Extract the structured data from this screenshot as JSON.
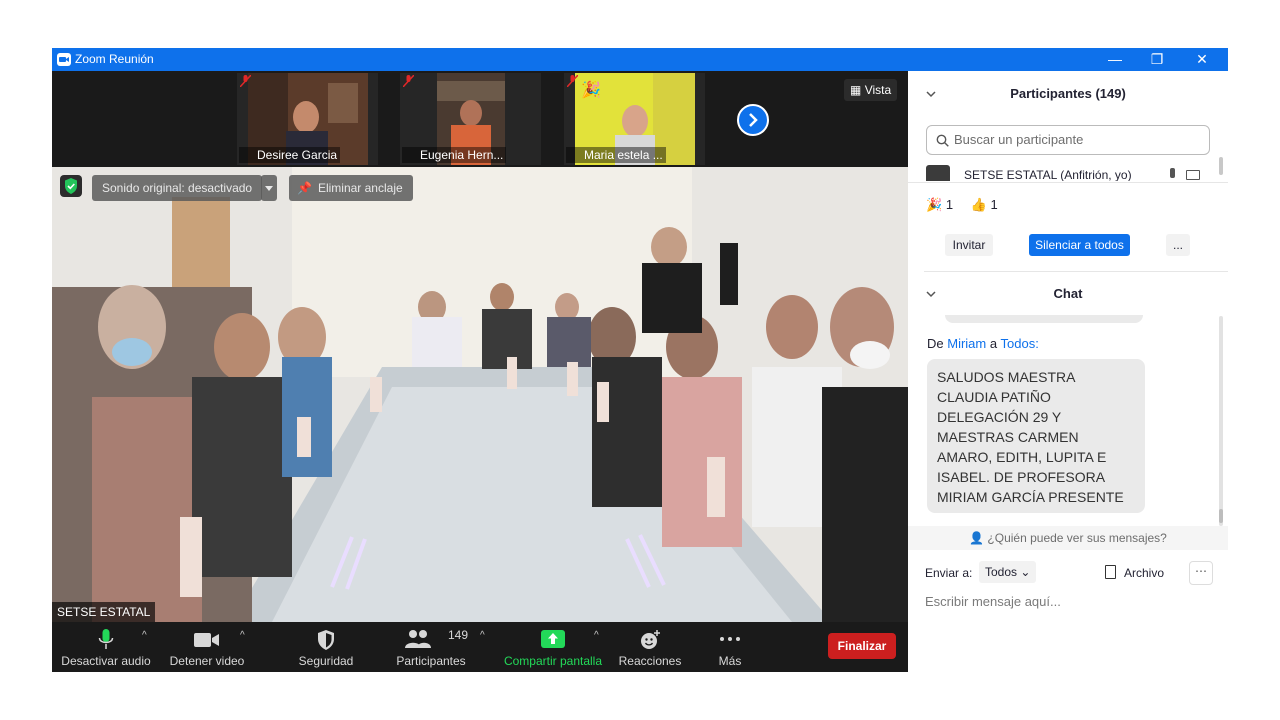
{
  "window": {
    "title": "Zoom Reunión",
    "min": "—",
    "restore": "❐",
    "close": "✕"
  },
  "strip": {
    "thumbs": [
      {
        "name": "Desiree Garcia"
      },
      {
        "name": "Eugenia Hern..."
      },
      {
        "name": "Maria estela ..."
      }
    ],
    "view_label": "Vista"
  },
  "main": {
    "sound_label": "Sonido original: desactivado",
    "unpin_label": "Eliminar anclaje",
    "speaker_name": "SETSE ESTATAL"
  },
  "toolbar": {
    "audio_label": "Desactivar audio",
    "video_label": "Detener video",
    "security_label": "Seguridad",
    "participants_label": "Participantes",
    "participants_count": "149",
    "share_label": "Compartir pantalla",
    "reactions_label": "Reacciones",
    "more_label": "Más",
    "end_label": "Finalizar"
  },
  "participants_panel": {
    "title": "Participantes (149)",
    "search_placeholder": "Buscar un participante",
    "first_row": "SETSE ESTATAL (Anfitrión, yo)",
    "reaction_1_count": "1",
    "reaction_2_count": "1",
    "invite_label": "Invitar",
    "mute_all_label": "Silenciar a todos",
    "more_label": "..."
  },
  "chat": {
    "title": "Chat",
    "from_prefix": "De",
    "sender": "Miriam",
    "to_word": "a",
    "recipient": "Todos:",
    "message": "SALUDOS MAESTRA CLAUDIA PATIÑO DELEGACIÓN 29 Y MAESTRAS CARMEN AMARO, EDITH, LUPITA E ISABEL. DE PROFESORA MIRIAM GARCÍA PRESENTE",
    "who_can_see": "¿Quién puede ver sus mensajes?",
    "send_to_label": "Enviar a:",
    "send_to_value": "Todos",
    "file_label": "Archivo",
    "compose_placeholder": "Escribir mensaje aquí..."
  },
  "colors": {
    "zoom_blue": "#0e71eb",
    "end_red": "#cc1f1f",
    "share_green": "#23d959"
  }
}
